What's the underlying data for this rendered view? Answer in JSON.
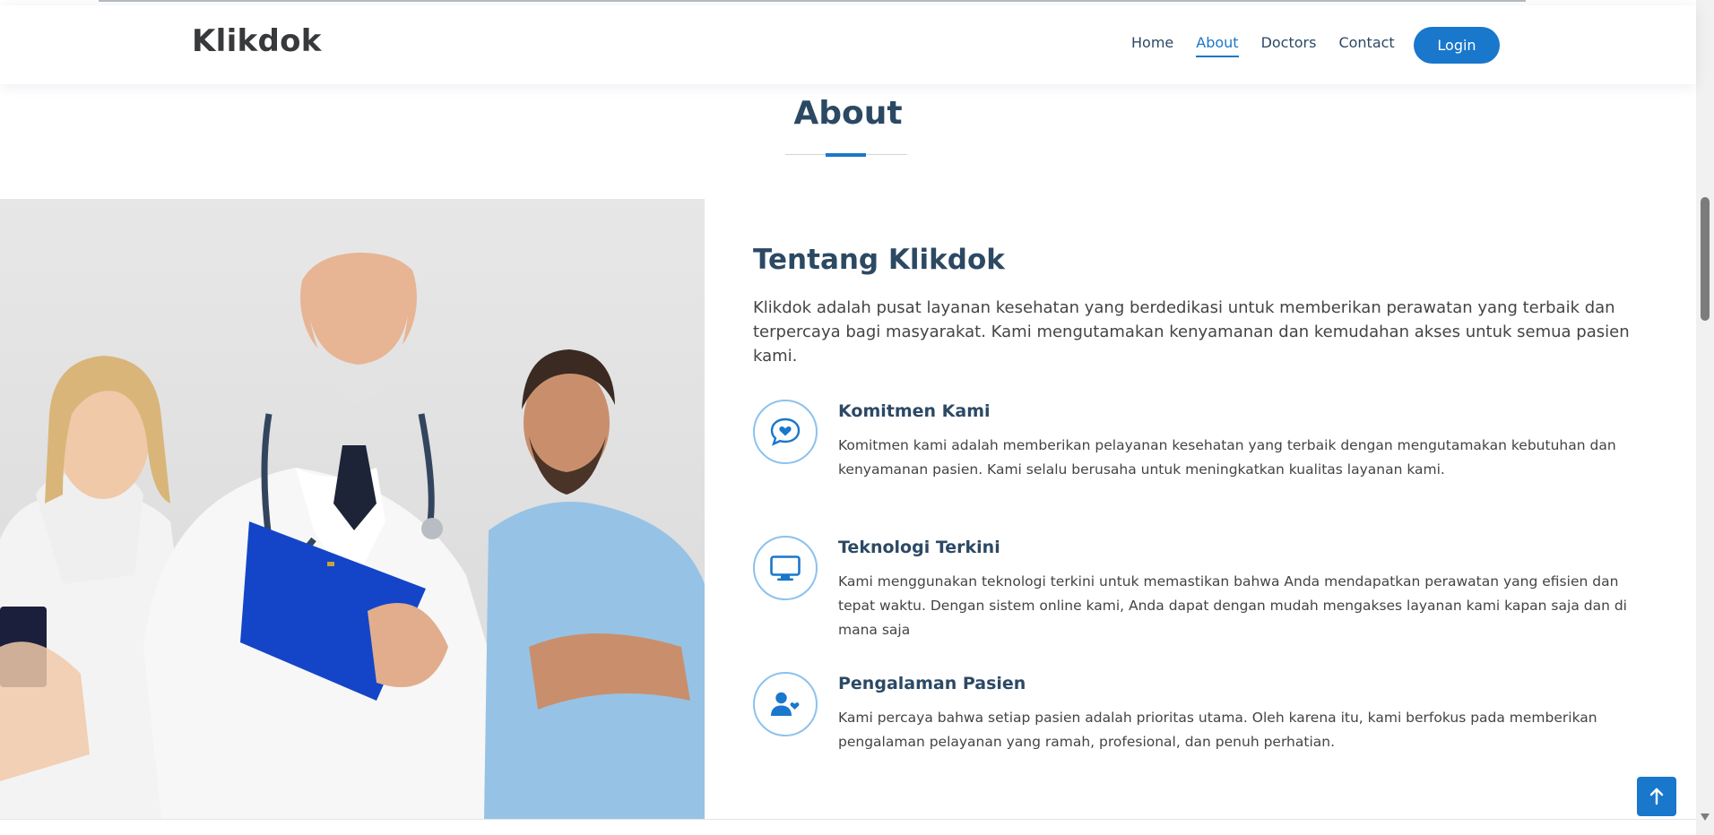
{
  "header": {
    "logo": "Klikdok",
    "nav": [
      "Home",
      "About",
      "Doctors",
      "Contact"
    ],
    "active_nav": "About",
    "login_label": "Login"
  },
  "section": {
    "title": "About"
  },
  "about": {
    "heading": "Tentang Klikdok",
    "intro": "Klikdok adalah pusat layanan kesehatan yang berdedikasi untuk memberikan perawatan yang terbaik dan terpercaya bagi masyarakat. Kami mengutamakan kenyamanan dan kemudahan akses untuk semua pasien kami.",
    "features": [
      {
        "icon": "chat-heart-icon",
        "title": "Komitmen Kami",
        "description": "Komitmen kami adalah memberikan pelayanan kesehatan yang terbaik dengan mengutamakan kebutuhan dan kenyamanan pasien. Kami selalu berusaha untuk meningkatkan kualitas layanan kami."
      },
      {
        "icon": "monitor-icon",
        "title": "Teknologi Terkini",
        "description": "Kami menggunakan teknologi terkini untuk memastikan bahwa Anda mendapatkan perawatan yang efisien dan tepat waktu. Dengan sistem online kami, Anda dapat dengan mudah mengakses layanan kami kapan saja dan di mana saja"
      },
      {
        "icon": "person-heart-icon",
        "title": "Pengalaman Pasien",
        "description": "Kami percaya bahwa setiap pasien adalah prioritas utama. Oleh karena itu, kami berfokus pada memberikan pengalaman pelayanan yang ramah, profesional, dan penuh perhatian."
      }
    ]
  },
  "colors": {
    "accent": "#1977cc",
    "heading": "#2c4964",
    "text": "#444444"
  }
}
